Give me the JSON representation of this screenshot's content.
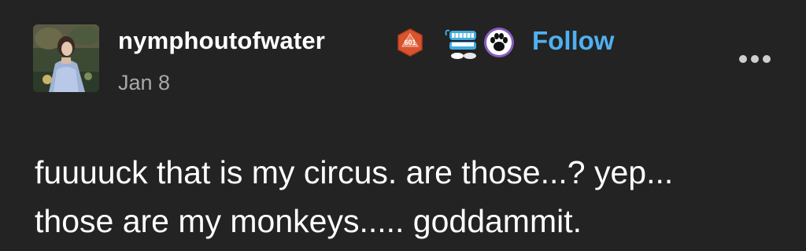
{
  "post": {
    "author": {
      "username": "nymphoutofwater",
      "avatar": "painting-portrait-avatar",
      "badges": [
        {
          "icon": "d20-dice-badge-icon",
          "text": "601",
          "color": "#d9532f"
        },
        {
          "icon": "chattering-teeth-badge-icon",
          "color": "#3fa9e0"
        },
        {
          "icon": "paw-print-badge-icon",
          "color": "#8a5cc2"
        }
      ]
    },
    "follow_label": "Follow",
    "date": "Jan 8",
    "more_icon": "more-options-icon",
    "body_lines": [
      "fuuuuck that is my circus. are those...? yep...",
      "those are my monkeys..... goddammit."
    ]
  },
  "colors": {
    "background": "#232323",
    "text": "#ffffff",
    "muted": "#a8a8a8",
    "accent": "#4fb0f0"
  }
}
